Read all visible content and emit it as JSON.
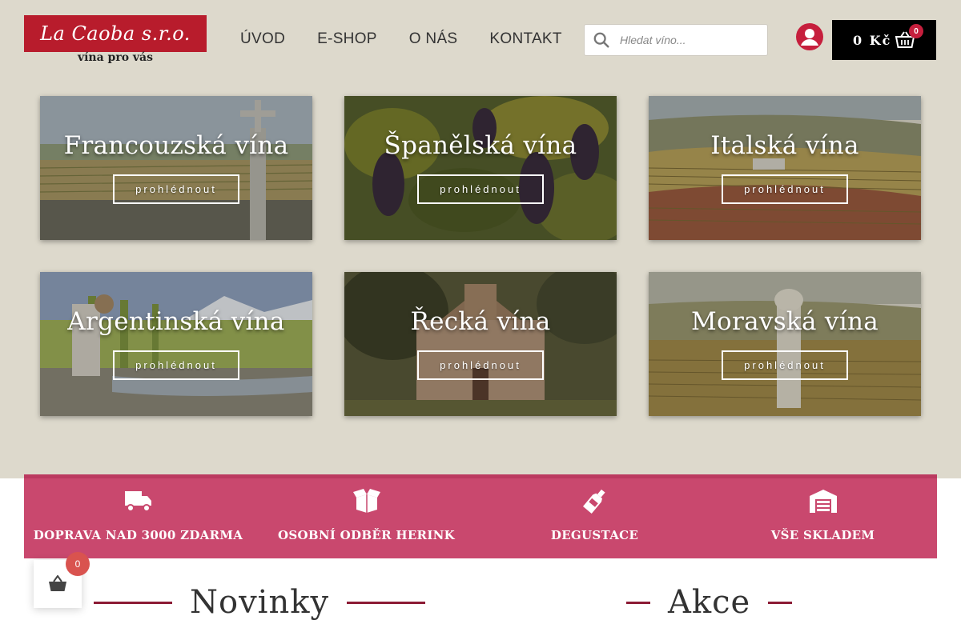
{
  "brand": {
    "logo_text": "La Caoba s.r.o.",
    "tagline": "vína pro vás",
    "primary_color": "#b81c2c",
    "accent_color": "#c9486e"
  },
  "nav": {
    "items": [
      "ÚVOD",
      "E-SHOP",
      "O NÁS",
      "KONTAKT"
    ]
  },
  "search": {
    "placeholder": "Hledat víno...",
    "icon": "search-icon"
  },
  "user": {
    "icon": "user-icon"
  },
  "cart": {
    "total": "0 Kč",
    "count": "0",
    "icon": "basket-icon"
  },
  "categories": [
    {
      "title": "Francouzská vína",
      "button": "prohlédnout"
    },
    {
      "title": "Španělská vína",
      "button": "prohlédnout"
    },
    {
      "title": "Italská vína",
      "button": "prohlédnout"
    },
    {
      "title": "Argentinská vína",
      "button": "prohlédnout"
    },
    {
      "title": "Řecká vína",
      "button": "prohlédnout"
    },
    {
      "title": "Moravská vína",
      "button": "prohlédnout"
    }
  ],
  "features": [
    {
      "label": "DOPRAVA NAD 3000 ZDARMA",
      "icon": "truck-icon"
    },
    {
      "label": "OSOBNÍ ODBĚR HERINK",
      "icon": "open-box-icon"
    },
    {
      "label": "DEGUSTACE",
      "icon": "wine-bottle-icon"
    },
    {
      "label": "VŠE SKLADEM",
      "icon": "warehouse-icon"
    }
  ],
  "floating_cart": {
    "count": "0",
    "icon": "basket-icon"
  },
  "sections": {
    "novinky": "Novinky",
    "akce": "Akce"
  }
}
